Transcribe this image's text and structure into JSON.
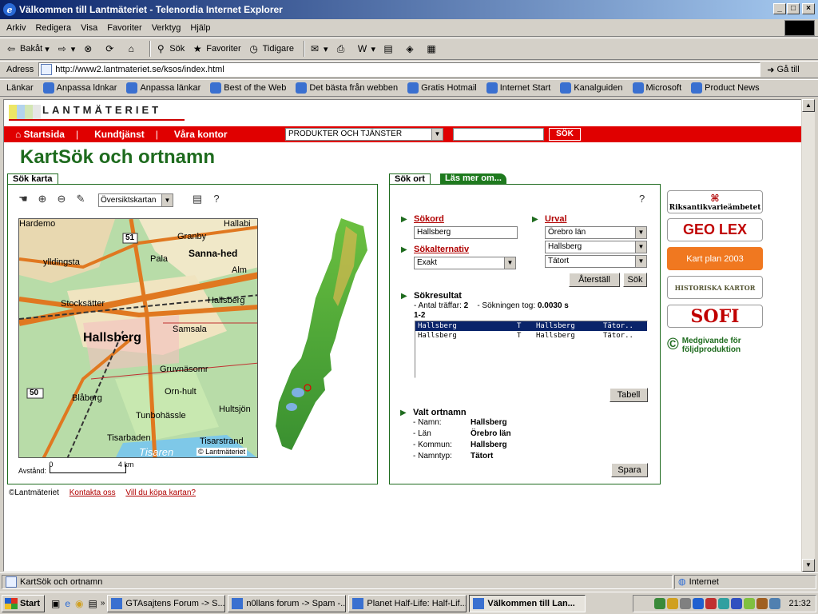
{
  "window": {
    "title": "Välkommen till Lantmäteriet - Telenordia Internet Explorer"
  },
  "menu": [
    "Arkiv",
    "Redigera",
    "Visa",
    "Favoriter",
    "Verktyg",
    "Hjälp"
  ],
  "toolbar": {
    "back": "Bakåt",
    "search": "Sök",
    "favorites": "Favoriter",
    "history": "Tidigare"
  },
  "address": {
    "label": "Adress",
    "url": "http://www2.lantmateriet.se/ksos/index.html",
    "go": "Gå till"
  },
  "links": {
    "label": "Länkar",
    "items": [
      "Anpassa ldnkar",
      "Anpassa länkar",
      "Best of the Web",
      "Det bästa från webben",
      "Gratis Hotmail",
      "Internet Start",
      "Kanalguiden",
      "Microsoft",
      "Product News"
    ]
  },
  "site": {
    "logo_text": "LANTMÄTERIET",
    "nav": [
      "Startsida",
      "Kundtjänst",
      "Våra kontor"
    ],
    "products_select": "PRODUKTER OCH TJÄNSTER",
    "search_button": "SÖK",
    "page_title": "KartSök och ortnamn"
  },
  "map_panel": {
    "tab": "Sök karta",
    "map_select": "Översiktskartan",
    "help": "?",
    "scale_label": "Avstånd:",
    "scale_start": "0",
    "scale_end": "4 km",
    "copyright": "© Lantmäteriet",
    "map_labels": {
      "hallsberg": "Hallsberg",
      "stocksatter": "Stocksätter",
      "granby": "Granby",
      "samsala": "Samsala",
      "sannahed": "Sanna-hed",
      "gruvnasomr": "Gruvnäsomr",
      "ornhult": "Orn-hult",
      "hultsjon": "Hultsjön",
      "tunbohassle": "Tunbohässle",
      "tisarbaden": "Tisarbaden",
      "tisarstrand": "Tisarstrand",
      "tisaren": "Tisaren",
      "blabarg": "Blåberg",
      "pala": "Pala",
      "alm": "Alm",
      "hallabi": "Hallabi",
      "ylldingsta": "ylldingsta",
      "hardemo": "Hardemo",
      "hallsberg_e": "Hallsberg",
      "road51": "51",
      "road50": "50"
    }
  },
  "search_panel": {
    "tab_active": "Sök ort",
    "tab_other": "Läs mer om...",
    "help": "?",
    "sokord_label": "Sökord",
    "sokord_value": "Hallsberg",
    "alt_label": "Sökalternativ",
    "alt_value": "Exakt",
    "urval_label": "Urval",
    "urval_values": [
      "Örebro län",
      "Hallsberg",
      "Tätort"
    ],
    "reset_button": "Återställ",
    "search_button": "Sök",
    "results_label": "Sökresultat",
    "hits_label": "- Antal träffar:",
    "hits_value": "2",
    "time_label": "- Sökningen tog:",
    "time_value": "0.0030 s",
    "range": "1-2",
    "rows": [
      [
        "Hallsberg",
        "T",
        "Hallsberg",
        "Tätor.."
      ],
      [
        "Hallsberg",
        "T",
        "Hallsberg",
        "Tätor.."
      ]
    ],
    "table_button": "Tabell",
    "selected_label": "Valt ortnamn",
    "selected": [
      {
        "key": "- Namn:",
        "value": "Hallsberg"
      },
      {
        "key": "- Län",
        "value": "Örebro län"
      },
      {
        "key": "- Kommun:",
        "value": "Hallsberg"
      },
      {
        "key": "- Namntyp:",
        "value": "Tätort"
      }
    ],
    "save_button": "Spara"
  },
  "side_logos": {
    "riksantikvarie": "Riksantikvarieämbetet",
    "geolex": "GEO LEX",
    "kartplan": "Kart plan 2003",
    "historiska": "HISTORISKA KARTOR",
    "sofi": "SOFI",
    "medgivande": "Medgivande för följdproduktion"
  },
  "footer": {
    "copyright": "©Lantmäteriet",
    "contact": "Kontakta oss",
    "buy": "Vill du köpa kartan?"
  },
  "status": {
    "text": "KartSök och ortnamn",
    "zone": "Internet"
  },
  "taskbar": {
    "start": "Start",
    "tasks": [
      "GTAsajtens Forum -> S...",
      "n0llans forum -> Spam -...",
      "Planet Half-Life: Half-Lif...",
      "Välkommen till Lan..."
    ],
    "clock": "21:32"
  }
}
